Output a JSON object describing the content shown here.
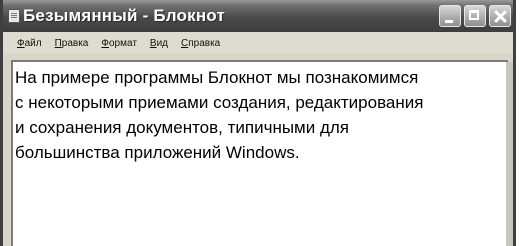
{
  "window": {
    "title": "Безымянный - Блокнот"
  },
  "menu": {
    "items": [
      {
        "label": "Файл"
      },
      {
        "label": "Правка"
      },
      {
        "label": "Формат"
      },
      {
        "label": "Вид"
      },
      {
        "label": "Справка"
      }
    ]
  },
  "editor": {
    "text": "На примере программы Блокнот мы познакомимся\nс некоторыми приемами создания, редактирования\nи сохранения документов, типичными для\nбольшинства приложений Windows."
  },
  "icons": {
    "app": "notepad-icon",
    "minimize": "minimize-icon",
    "maximize": "maximize-icon",
    "close": "close-icon"
  },
  "colors": {
    "titlebar": "#4a4a4a",
    "frame": "#d9d5c9",
    "editor_background": "#ffffff"
  }
}
